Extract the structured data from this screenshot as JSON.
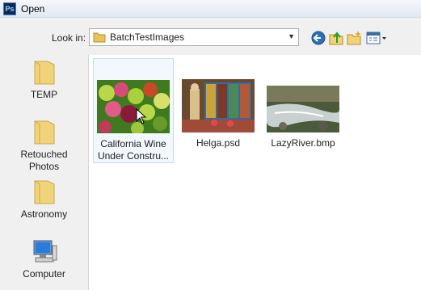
{
  "window": {
    "title": "Open",
    "app_icon": "Ps"
  },
  "toolbar": {
    "look_in_label": "Look in:",
    "location": "BatchTestImages",
    "buttons": [
      "back-icon",
      "up-folder-icon",
      "new-folder-icon",
      "views-icon"
    ]
  },
  "places": [
    {
      "label": "TEMP",
      "icon": "folder-icon"
    },
    {
      "label": "Retouched Photos",
      "icon": "folder-icon"
    },
    {
      "label": "Astronomy",
      "icon": "folder-icon"
    },
    {
      "label": "Computer",
      "icon": "computer-icon"
    }
  ],
  "files": [
    {
      "name": "California Wine Under Constru...",
      "selected": true
    },
    {
      "name": "Helga.psd",
      "selected": false
    },
    {
      "name": "LazyRiver.bmp",
      "selected": false
    }
  ],
  "colors": {
    "selection_fill": "#f2f8fd",
    "selection_border": "#c3dbf1",
    "folder": "#f1d37a"
  }
}
